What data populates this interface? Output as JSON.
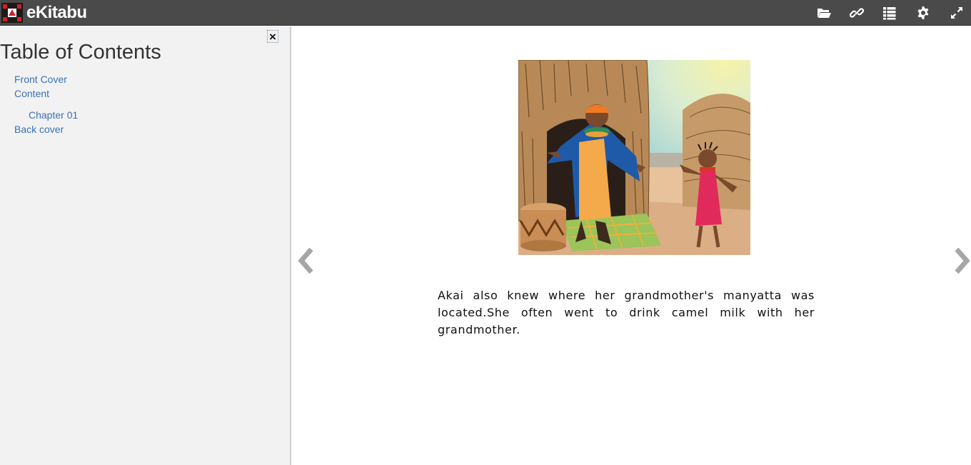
{
  "app": {
    "brand_name": "eKitabu",
    "logo_icon": "ekitabu-logo-icon",
    "colors": {
      "topbar": "#4a4a4a",
      "sidebar": "#f2f2f2",
      "link": "#3a70b8"
    }
  },
  "toolbar": {
    "buttons": [
      {
        "icon": "folder-open-icon"
      },
      {
        "icon": "link-icon"
      },
      {
        "icon": "list-icon"
      },
      {
        "icon": "gear-icon"
      },
      {
        "icon": "fullscreen-icon"
      }
    ]
  },
  "sidebar": {
    "title": "Table of Contents",
    "close_label": "×",
    "items": [
      {
        "label": "Front Cover",
        "level": 0
      },
      {
        "label": "Content",
        "level": 0
      },
      {
        "label": "Chapter 01",
        "level": 1
      },
      {
        "label": "Back cover",
        "level": 0
      }
    ]
  },
  "reader": {
    "prev_icon": "chevron-left-icon",
    "next_icon": "chevron-right-icon",
    "page_text": "Akai also knew where her grandmother's manyatta was located.She often went to drink camel milk with her grandmother."
  }
}
